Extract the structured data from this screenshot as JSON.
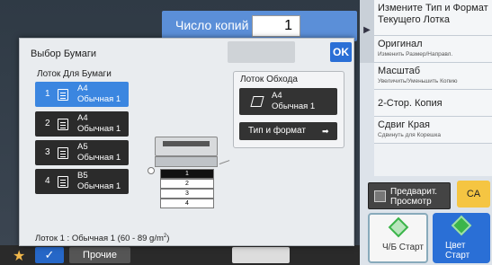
{
  "copies": {
    "label": "Число копий",
    "value": "1"
  },
  "right_panel": {
    "items": [
      {
        "title": "Измените Тип и Формат Текущего Лотка",
        "sub": ""
      },
      {
        "title": "Оригинал",
        "sub": "Изменить Размер/Направл."
      },
      {
        "title": "Масштаб",
        "sub": "Увеличить/Уменьшить Копию"
      },
      {
        "title": "2-Стор. Копия",
        "sub": ""
      },
      {
        "title": "Сдвиг Края",
        "sub": "Сдвинуть для Корешка"
      }
    ],
    "preview_label": "Предварит. Просмотр",
    "ca_label": "CA",
    "bw_start": "Ч/Б Старт",
    "color_start": "Цвет Старт"
  },
  "bottom_bar": {
    "other_label": "Прочие"
  },
  "dialog": {
    "title": "Выбор Бумаги",
    "ok_label": "OK",
    "trays_label": "Лоток Для Бумаги",
    "trays": [
      {
        "num": "1",
        "size": "A4",
        "type": "Обычная 1",
        "selected": true
      },
      {
        "num": "2",
        "size": "A4",
        "type": "Обычная 1",
        "selected": false
      },
      {
        "num": "3",
        "size": "A5",
        "type": "Обычная 1",
        "selected": false
      },
      {
        "num": "4",
        "size": "B5",
        "type": "Обычная 1",
        "selected": false
      }
    ],
    "bypass": {
      "label": "Лоток Обхода",
      "size": "A4",
      "type": "Обычная 1",
      "type_format_label": "Тип и формат"
    },
    "printer_drawers": [
      "1",
      "2",
      "3",
      "4"
    ],
    "footer_info": "Лоток 1 : Обычная 1 (60 - 89 g/m",
    "footer_sup": "2",
    "footer_end": ")"
  },
  "colors": {
    "accent": "#3b86e0",
    "ok_blue": "#2a6fd6",
    "ca_yellow": "#f5c542",
    "start_green": "#3bb54a"
  }
}
